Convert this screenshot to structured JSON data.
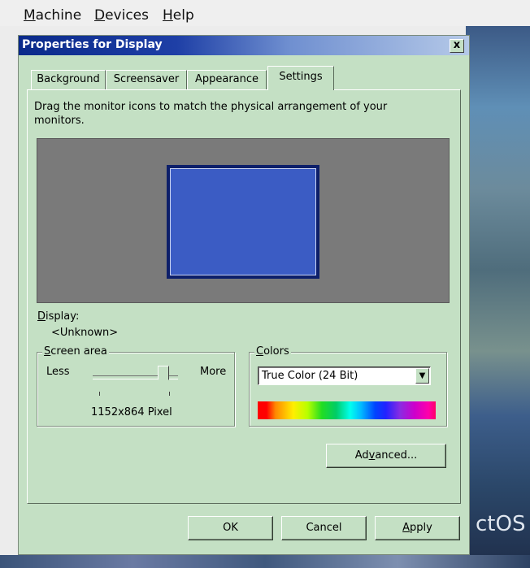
{
  "menubar": {
    "items": [
      {
        "label": "Machine",
        "accel": "M",
        "rest": "achine"
      },
      {
        "label": "Devices",
        "accel": "D",
        "rest": "evices"
      },
      {
        "label": "Help",
        "accel": "H",
        "rest": "elp"
      }
    ]
  },
  "dialog": {
    "title": "Properties for Display",
    "close_label": "x",
    "tabs": [
      {
        "label": "Background"
      },
      {
        "label": "Screensaver"
      },
      {
        "label": "Appearance"
      },
      {
        "label": "Settings",
        "active": true
      }
    ],
    "description": "Drag the monitor icons to match the physical arrangement of your monitors.",
    "display_label": "Display:",
    "display_value": "<Unknown>",
    "screen_area": {
      "label": "Screen area",
      "less": "Less",
      "more": "More",
      "resolution": "1152x864 Pixel",
      "slider_position": 0.88
    },
    "colors": {
      "label": "Colors",
      "selected": "True Color (24 Bit)"
    },
    "advanced_prefix": "Ad",
    "advanced_accel": "v",
    "advanced_suffix": "anced...",
    "buttons": {
      "ok": "OK",
      "cancel": "Cancel",
      "apply": "Apply"
    }
  },
  "desktop_text": "ctOS",
  "colors": {
    "dialog_bg": "#c4e0c4",
    "title_start": "#0a2a8a",
    "monitor_fill": "#3b5cc4"
  }
}
